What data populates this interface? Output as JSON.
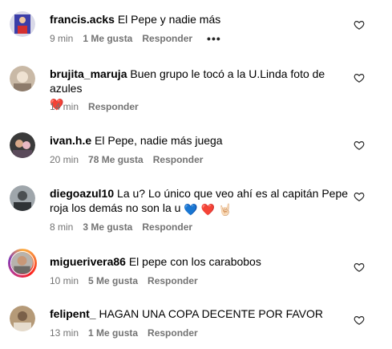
{
  "comments": [
    {
      "username": "francis.acks",
      "text": "El Pepe y nadie más",
      "time": "9 min",
      "likes": "1 Me gusta",
      "reply": "Responder",
      "more": "•••"
    },
    {
      "username": "brujita_maruja",
      "text": "Buen grupo le tocó a la U.Linda foto de azules",
      "emoji": "❤️",
      "time": "14 min",
      "reply": "Responder"
    },
    {
      "username": "ivan.h.e",
      "text": "El Pepe, nadie más juega",
      "time": "20 min",
      "likes": "78 Me gusta",
      "reply": "Responder"
    },
    {
      "username": "diegoazul10",
      "text": "La u? Lo único que veo ahí es al capitán Pepe roja los demás no son la u",
      "emojis": [
        "💙",
        "❤️",
        "🤘🏻"
      ],
      "time": "8 min",
      "likes": "3 Me gusta",
      "reply": "Responder"
    },
    {
      "username": "miguerivera86",
      "text": "El pepe con los carabobos",
      "time": "10 min",
      "likes": "5 Me gusta",
      "reply": "Responder"
    },
    {
      "username": "felipent_",
      "text": "HAGAN UNA COPA DECENTE POR FAVOR",
      "time": "13 min",
      "likes": "1 Me gusta",
      "reply": "Responder"
    }
  ],
  "icons": {
    "like": "heart-outline-icon"
  },
  "colors": {
    "meta_text": "#737373",
    "heart_red": "#e0245e",
    "heart_blue": "#2a6fd6"
  }
}
